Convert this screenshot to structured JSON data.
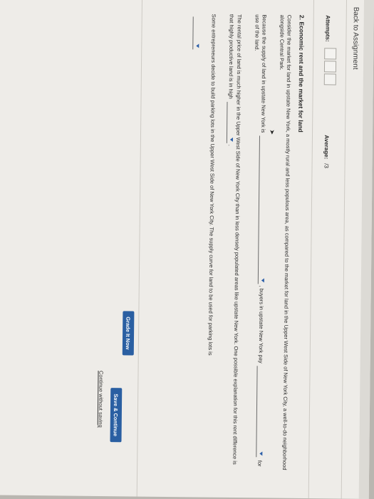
{
  "nav": {
    "back_label": "Back to Assignment"
  },
  "attempts": {
    "label": "Attempts:",
    "average_label": "Average:",
    "average_value": "/3"
  },
  "question": {
    "title": "2. Economic rent and the market for land",
    "intro": "Consider the market for land in upstate New York, a mostly rural and less populous area, as compared to the market for land in the Upper West Side of New York City, a well-to-do neighborhood alongside Central Park.",
    "p2_part1": "Because the supply of land in upstate New York is",
    "p2_part2": ", buyers in upstate New York pay",
    "p2_part3": "for use of the land.",
    "p3_part1": "The rental price of land is much higher in the Upper West Side of New York City than in less densely populated areas like upstate New York. One possible explanation for this rent difference is that highly productive land is in high",
    "p3_part2": ".",
    "p4": "Some entrepreneurs decide to build parking lots in the Upper West Side of New York City. The supply curve for land to be used for parking lots is"
  },
  "buttons": {
    "grade_label": "Grade It Now",
    "save_label": "Save & Continue",
    "continue_label": "Continue without saving"
  },
  "colors": {
    "accent": "#2a5fa2",
    "page_bg": "#eeece8"
  }
}
